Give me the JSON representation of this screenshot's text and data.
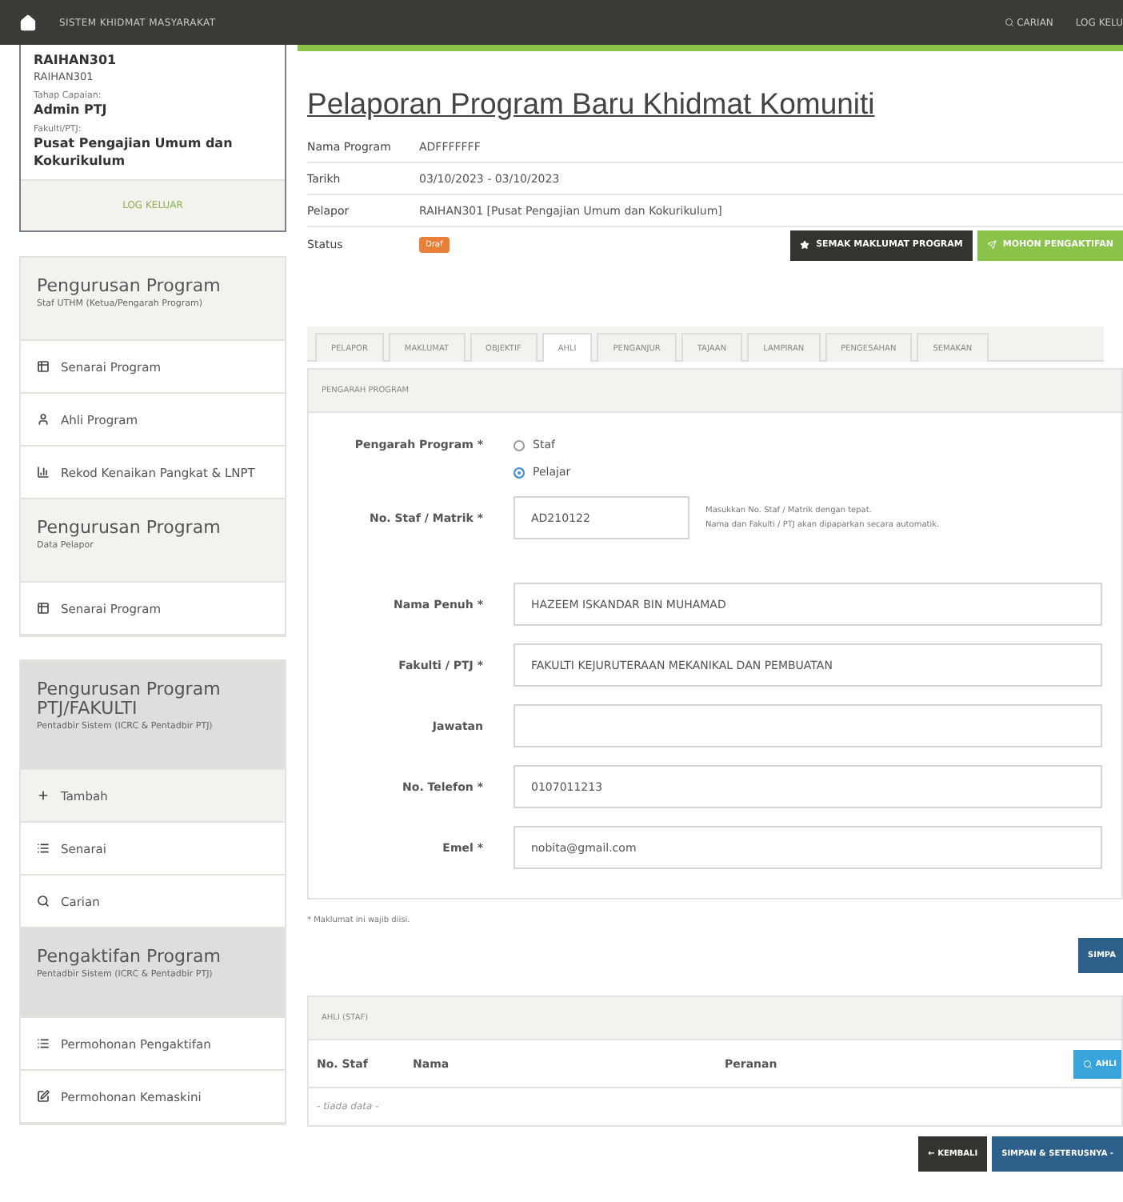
{
  "topbar": {
    "title": "SISTEM KHIDMAT MASYARAKAT",
    "links": [
      {
        "label": "CARIAN",
        "kind": "search"
      },
      {
        "label": "LOG KELU",
        "kind": "plain"
      }
    ]
  },
  "user_card": {
    "name": "RAIHAN301",
    "id": "RAIHAN301",
    "fields": [
      {
        "label": "Tahap Capaian:",
        "value": "Admin PTJ"
      },
      {
        "label": "Fakulti/PTJ:",
        "value": "Pusat Pengajian Umum dan Kokurikulum"
      }
    ],
    "logout": "LOG KELUAR"
  },
  "sidebar_groups": [
    {
      "kind": "staff",
      "sections": [
        {
          "title": "Pengurusan Program",
          "subtitle": "Staf UTHM (Ketua/Pengarah Program)",
          "items": [
            {
              "label": "Senarai Program",
              "kind": "list",
              "selected": false
            },
            {
              "label": "Ahli Program",
              "kind": "user",
              "selected": false
            },
            {
              "label": "Rekod Kenaikan Pangkat & LNPT",
              "kind": "chart",
              "selected": false
            }
          ]
        },
        {
          "title": "Pengurusan Program",
          "subtitle": "Data Pelapor",
          "items": [
            {
              "label": "Senarai Program",
              "kind": "list",
              "selected": false
            }
          ]
        }
      ]
    },
    {
      "kind": "admin",
      "sections": [
        {
          "title": "Pengurusan Program PTJ/FAKULTI",
          "subtitle": "Pentadbir Sistem (ICRC & Pentadbir PTJ)",
          "items": [
            {
              "label": "Tambah",
              "kind": "plus",
              "selected": true
            },
            {
              "label": "Senarai",
              "kind": "bars",
              "selected": false
            },
            {
              "label": "Carian",
              "kind": "search",
              "selected": false
            }
          ]
        },
        {
          "title": "Pengaktifan Program",
          "subtitle": "Pentadbir Sistem (ICRC & Pentadbir PTJ)",
          "items": [
            {
              "label": "Permohonan Pengaktifan",
              "kind": "bars",
              "selected": false
            },
            {
              "label": "Permohonan Kemaskini",
              "kind": "edit",
              "selected": false
            }
          ]
        }
      ]
    }
  ],
  "page_title": "Pelaporan Program Baru Khidmat Komuniti",
  "info": [
    {
      "label": "Nama Program",
      "value": "ADFFFFFFF"
    },
    {
      "label": "Tarikh",
      "value": "03/10/2023 - 03/10/2023"
    },
    {
      "label": "Pelapor",
      "value": "RAIHAN301 [Pusat Pengajian Umum dan Kokurikulum]"
    }
  ],
  "status": {
    "label": "Status",
    "badge": "Draf"
  },
  "actions": [
    {
      "label": "SEMAK MAKLUMAT PROGRAM",
      "kind": "dark"
    },
    {
      "label": "MOHON PENGAKTIFAN",
      "kind": "green"
    }
  ],
  "tabs": [
    {
      "label": "PELAPOR",
      "selected": false
    },
    {
      "label": "MAKLUMAT",
      "selected": false
    },
    {
      "label": "OBJEKTIF",
      "selected": false
    },
    {
      "label": "AHLI",
      "selected": true
    },
    {
      "label": "PENGANJUR",
      "selected": false
    },
    {
      "label": "TAJAAN",
      "selected": false
    },
    {
      "label": "LAMPIRAN",
      "selected": false
    },
    {
      "label": "PENGESAHAN",
      "selected": false
    },
    {
      "label": "SEMAKAN",
      "selected": false
    }
  ],
  "form": {
    "heading": "PENGARAH PROGRAM",
    "radio_label": "Pengarah Program *",
    "options": [
      {
        "label": "Staf",
        "selected": false
      },
      {
        "label": "Pelajar",
        "selected": true
      }
    ],
    "fields": [
      {
        "label": "No. Staf / Matrik *",
        "value": "AD210122",
        "kind": "short",
        "help": [
          "Masukkan No. Staf / Matrik dengan tepat.",
          "Nama dan Fakulti / PTJ akan dipaparkan secara automatik."
        ]
      },
      {
        "label": "Nama Penuh *",
        "value": "HAZEEM ISKANDAR BIN MUHAMAD",
        "kind": "wide"
      },
      {
        "label": "Fakulti / PTJ *",
        "value": "FAKULTI KEJURUTERAAN MEKANIKAL DAN PEMBUATAN",
        "kind": "wide"
      },
      {
        "label": "Jawatan",
        "kind": "wide"
      },
      {
        "label": "No. Telefon *",
        "value": "0107011213",
        "kind": "wide"
      },
      {
        "label": "Emel *",
        "value": "nobita@gmail.com",
        "kind": "wide"
      }
    ]
  },
  "note": "* Maklumat ini wajib diisi.",
  "save_button": "SIMPA",
  "members": {
    "heading": "AHLI (STAF)",
    "columns": [
      "No. Staf",
      "Nama",
      "Peranan"
    ],
    "add_button": "AHLI",
    "empty": "- tiada data -"
  },
  "footer_buttons": [
    {
      "label": "← KEMBALI",
      "kind": "dark"
    },
    {
      "label": "SIMPAN & SETERUSNYA -",
      "kind": "primary"
    }
  ]
}
